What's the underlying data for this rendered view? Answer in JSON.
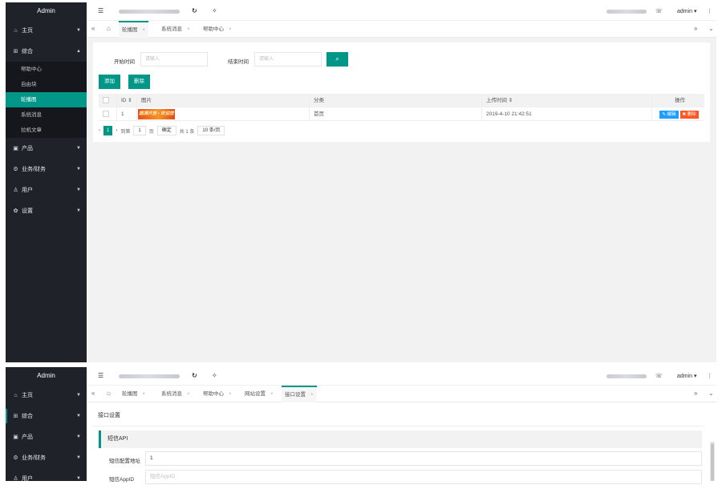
{
  "top": {
    "sidebar": {
      "title": "Admin",
      "menu": [
        {
          "label": "主页",
          "icon": "home-icon",
          "glyph": "⌂"
        },
        {
          "label": "综合",
          "icon": "grid-icon",
          "glyph": "⊞",
          "expanded": true,
          "children": [
            "帮助中心",
            "自由块",
            "轮播图",
            "系统消息",
            "拉机文章"
          ]
        },
        {
          "label": "产品",
          "icon": "product-icon",
          "glyph": "▣"
        },
        {
          "label": "业务/财务",
          "icon": "finance-icon",
          "glyph": "⚙"
        },
        {
          "label": "用户",
          "icon": "user-icon",
          "glyph": "♙"
        },
        {
          "label": "设置",
          "icon": "settings-icon",
          "glyph": "✿"
        }
      ],
      "active_child": "轮播图"
    },
    "topbar": {
      "url": "http://www.example.net",
      "user": "admin ▾",
      "account": "www.example.net"
    },
    "tabs": [
      "轮播图",
      "系统消息",
      "帮助中心"
    ],
    "active_tab": "轮播图",
    "filters": {
      "start_label": "开始时间",
      "start_placeholder": "请输入",
      "end_label": "结束时间",
      "end_placeholder": "请输入"
    },
    "buttons": {
      "add": "添加",
      "delete": "删除"
    },
    "table": {
      "headers": {
        "id": "ID ⇕",
        "image": "图片",
        "category": "分类",
        "time": "上传时间 ⇕",
        "actions": "操作"
      },
      "rows": [
        {
          "id": "1",
          "image_text": "圆满开放 • 欢迎您",
          "category": "首页",
          "time": "2019-4-10 21:42:51"
        }
      ],
      "edit": "✎ 编辑",
      "remove": "✖ 删除"
    },
    "pager": {
      "prev": "‹",
      "page": "1",
      "next": "›",
      "goto": "到第",
      "input": "1",
      "unit": "页",
      "confirm": "确定",
      "total": "共 1 条",
      "per_page": "10 条/页"
    }
  },
  "bottom": {
    "sidebar": {
      "title": "Admin",
      "menu": [
        {
          "label": "主页",
          "icon": "home-icon",
          "glyph": "⌂"
        },
        {
          "label": "综合",
          "icon": "grid-icon",
          "glyph": "⊞"
        },
        {
          "label": "产品",
          "icon": "product-icon",
          "glyph": "▣"
        },
        {
          "label": "业务/财务",
          "icon": "finance-icon",
          "glyph": "⚙"
        },
        {
          "label": "用户",
          "icon": "user-icon",
          "glyph": "♙"
        }
      ]
    },
    "topbar": {
      "url": "http://www.example.net",
      "user": "admin ▾",
      "account": "www.example.net"
    },
    "tabs": [
      "轮播图",
      "系统消息",
      "帮助中心",
      "网站设置",
      "接口设置"
    ],
    "active_tab": "接口设置",
    "section_title": "接口设置",
    "section_quote": "短信API",
    "fields": [
      {
        "label": "短信配置地址",
        "value": "1"
      },
      {
        "label": "短信AppID",
        "placeholder": "短信AppID"
      }
    ]
  },
  "colors": {
    "accent": "#009688",
    "sidebar": "#20222a",
    "edit": "#1e9fff",
    "danger": "#ff5722"
  }
}
